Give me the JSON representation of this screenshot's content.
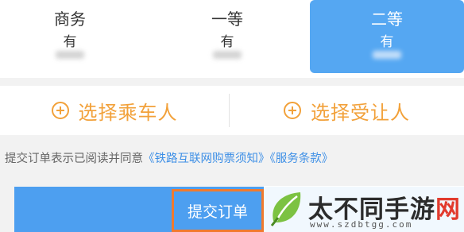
{
  "seats": [
    {
      "class": "商务",
      "availability": "有",
      "selected": false
    },
    {
      "class": "一等",
      "availability": "有",
      "selected": false
    },
    {
      "class": "二等",
      "availability": "有",
      "selected": true
    }
  ],
  "passenger_actions": {
    "select_passenger": "选择乘车人",
    "select_beneficiary": "选择受让人"
  },
  "agreement": {
    "prefix": "提交订单表示已阅读并同意",
    "notice_link": "《铁路互联网购票须知》",
    "terms_link": "《服务条款》"
  },
  "submit": {
    "label": "提交订单"
  },
  "watermark": {
    "title_main": "太不同手游",
    "title_accent": "网",
    "url": "www.szdbtgg.com"
  },
  "colors": {
    "selected_blue": "#55a7f2",
    "accent_orange": "#f2a13a",
    "link_blue": "#3d8fe6"
  }
}
